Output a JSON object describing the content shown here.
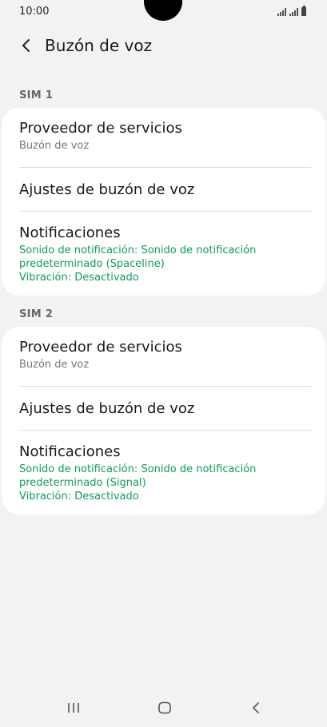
{
  "status_bar": {
    "time": "10:00"
  },
  "header": {
    "title": "Buzón de voz"
  },
  "sections": [
    {
      "label": "SIM 1",
      "items": [
        {
          "title": "Proveedor de servicios",
          "subtitle": "Buzón de voz"
        },
        {
          "title": "Ajustes de buzón de voz"
        },
        {
          "title": "Notificaciones",
          "line1": "Sonido de notificación: Sonido de notificación",
          "line2": "predeterminado (Spaceline)",
          "line3": "Vibración: Desactivado"
        }
      ]
    },
    {
      "label": "SIM 2",
      "items": [
        {
          "title": "Proveedor de servicios",
          "subtitle": "Buzón de voz"
        },
        {
          "title": "Ajustes de buzón de voz"
        },
        {
          "title": "Notificaciones",
          "line1": "Sonido de notificación: Sonido de notificación",
          "line2": "predeterminado (Signal)",
          "line3": "Vibración: Desactivado"
        }
      ]
    }
  ],
  "colors": {
    "accent_green": "#0f9d58",
    "background": "#f2f2f2",
    "card": "#ffffff"
  },
  "icons": {
    "back": "chevron-left-icon",
    "recents": "recents-icon",
    "home": "home-icon",
    "nav_back": "nav-back-icon"
  }
}
